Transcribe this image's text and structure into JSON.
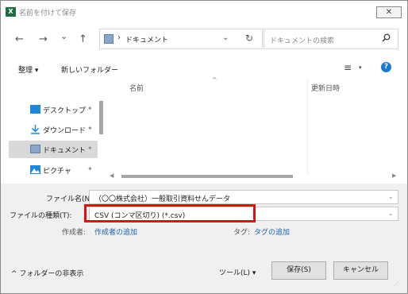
{
  "window": {
    "app_icon": "X",
    "title": "名前を付けて保存",
    "close_glyph": "✕"
  },
  "nav": {
    "back": "←",
    "forward": "→",
    "recent": "⌄",
    "up": "↑",
    "path": "ドキュメント",
    "path_separator": "›",
    "dropdown": "⌄",
    "refresh": "↻",
    "search_placeholder": "ドキュメントの検索"
  },
  "toolbar": {
    "organize": "整理 ▾",
    "new_folder": "新しいフォルダー",
    "view_icon": "≡",
    "view_caret": "▾",
    "help": "?"
  },
  "sidebar": {
    "items": [
      {
        "label": "デスクトップ",
        "icon": "desktop-icon",
        "color": "#1e88d6"
      },
      {
        "label": "ダウンロード",
        "icon": "download-icon",
        "color": "#1e88d6"
      },
      {
        "label": "ドキュメント",
        "icon": "document-icon",
        "color": "#8aa5c7"
      },
      {
        "label": "ピクチャ",
        "icon": "pictures-icon",
        "color": "#1e88d6"
      }
    ],
    "pin_glyph": "✦"
  },
  "filelist": {
    "columns": [
      "名前",
      "更新日時"
    ],
    "sort_glyph": "^",
    "scroll_left": "◀",
    "scroll_right": "▶"
  },
  "form": {
    "filename_label": "ファイル名(N):",
    "filename_value": "（〇〇株式会社）一般取引資料せんデータ",
    "filetype_label": "ファイルの種類(T):",
    "filetype_value": "CSV (コンマ区切り) (*.csv)",
    "dropdown_glyph": "⌄",
    "author_label": "作成者:",
    "author_link": "作成者の追加",
    "tags_label": "タグ:",
    "tags_link": "タグの追加"
  },
  "footer": {
    "hide_folders": "^ フォルダーの非表示",
    "tools": "ツール(L) ▾",
    "save": "保存(S)",
    "cancel": "キャンセル"
  },
  "colors": {
    "highlight": "#e01010",
    "link": "#1a5fb4"
  }
}
